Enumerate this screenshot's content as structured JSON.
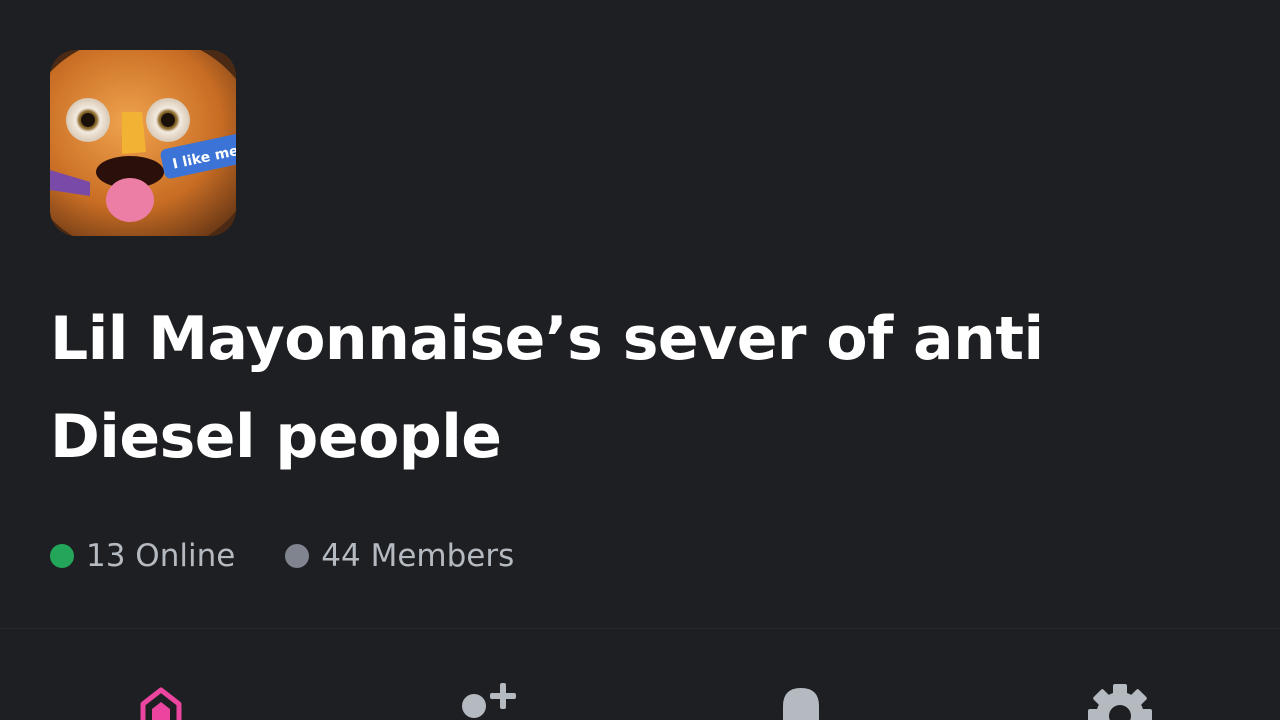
{
  "server": {
    "name": "Lil Mayonnaise’s sever of anti Diesel people",
    "icon_caption": "I like men",
    "online_count": "13 Online",
    "member_count": "44 Members"
  },
  "status_colors": {
    "online": "#23a55a",
    "members": "#80848e"
  },
  "actions": [
    {
      "name": "boosts",
      "icon": "boost-gem-icon",
      "color": "#eb459f"
    },
    {
      "name": "invite",
      "icon": "add-person-icon"
    },
    {
      "name": "notifications",
      "icon": "bell-icon"
    },
    {
      "name": "settings",
      "icon": "gear-icon"
    }
  ]
}
